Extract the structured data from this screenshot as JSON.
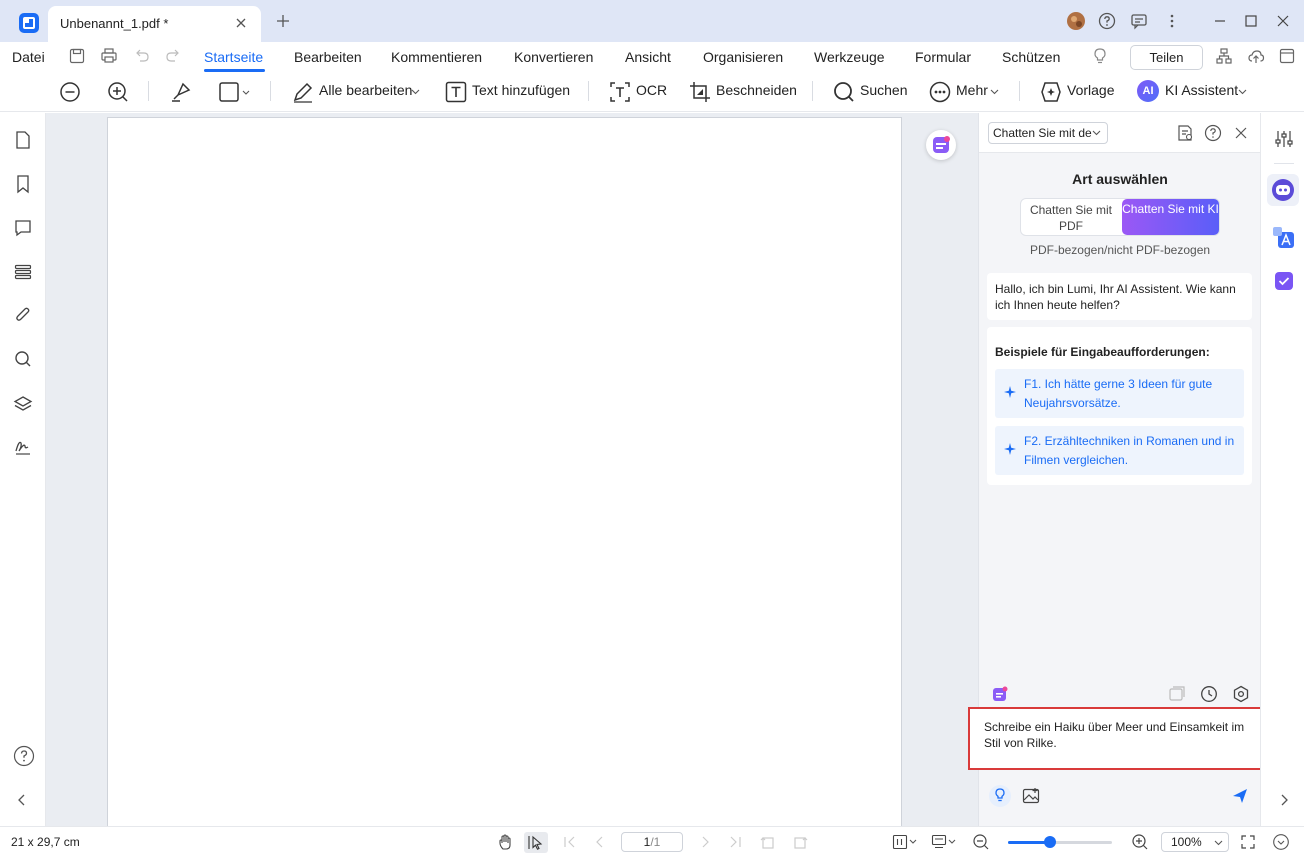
{
  "titlebar": {
    "tab_title": "Unbenannt_1.pdf *"
  },
  "menu": {
    "file": "Datei",
    "items": [
      "Startseite",
      "Bearbeiten",
      "Kommentieren",
      "Konvertieren",
      "Ansicht",
      "Organisieren",
      "Werkzeuge",
      "Formular",
      "Schützen"
    ],
    "active": "Startseite",
    "share": "Teilen"
  },
  "toolbar": {
    "edit_all": "Alle bearbeiten",
    "add_text": "Text hinzufügen",
    "ocr": "OCR",
    "crop": "Beschneiden",
    "search": "Suchen",
    "more": "Mehr",
    "template": "Vorlage",
    "ai_badge": "AI",
    "ai_assistant": "KI Assistent"
  },
  "ai_panel": {
    "mode_select": "Chatten Sie mit de",
    "type_title": "Art auswählen",
    "seg_pdf": "Chatten Sie mit PDF",
    "seg_ki": "Chatten Sie mit KI",
    "seg_sub": "PDF-bezogen/nicht PDF-bezogen",
    "greeting": "Hallo, ich bin Lumi, Ihr AI Assistent. Wie kann ich Ihnen heute helfen?",
    "examples_title": "Beispiele für Eingabeaufforderungen:",
    "examples": [
      "F1. Ich hätte gerne 3 Ideen für gute Neujahrsvorsätze.",
      "F2. Erzähltechniken in Romanen und in Filmen vergleichen."
    ],
    "input_value": "Schreibe ein Haiku über Meer und Einsamkeit im Stil von Rilke."
  },
  "status": {
    "page_size": "21 x 29,7 cm",
    "page_current": "1",
    "page_total": "/1",
    "zoom": "100%",
    "zoom_level": 0.4
  },
  "colors": {
    "accent": "#1a6cf5",
    "ai_gradient_start": "#9b58f5",
    "ai_gradient_end": "#5a5ef8",
    "highlight_border": "#d93a3a"
  }
}
